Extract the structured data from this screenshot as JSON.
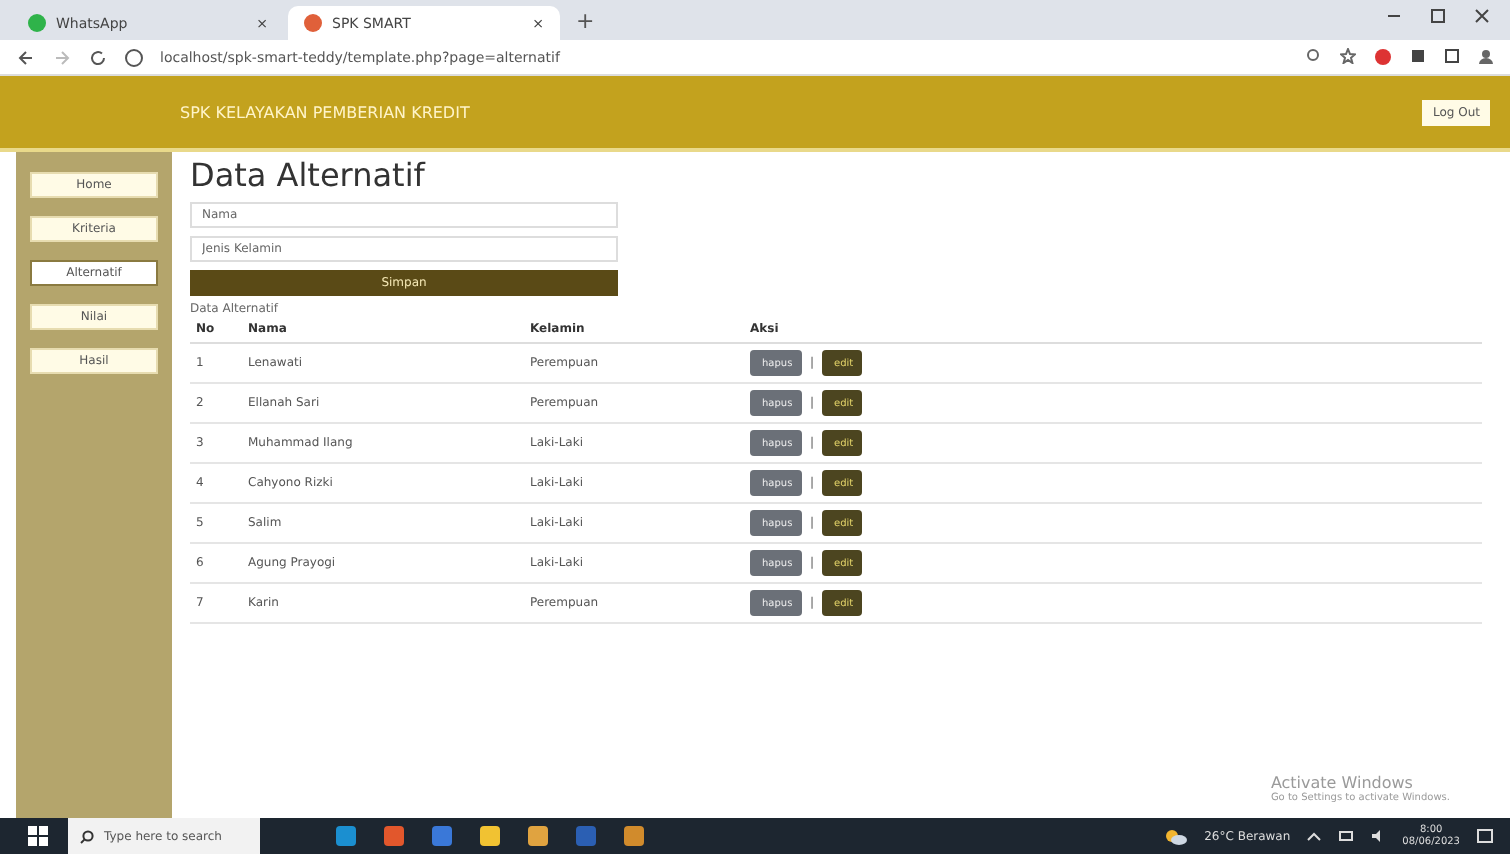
{
  "browser": {
    "tabs": [
      {
        "title": "WhatsApp",
        "close": "×",
        "selected": false
      },
      {
        "title": "SPK SMART",
        "close": "×",
        "selected": true
      }
    ],
    "new_tab": "+",
    "url": "localhost/spk-smart-teddy/template.php?page=alternatif"
  },
  "header": {
    "title": "SPK KELAYAKAN PEMBERIAN KREDIT",
    "logout": "Log Out"
  },
  "sidebar": {
    "items": [
      {
        "label": "Home",
        "selected": false
      },
      {
        "label": "Kriteria",
        "selected": false
      },
      {
        "label": "Alternatif",
        "selected": true
      },
      {
        "label": "Nilai",
        "selected": false
      },
      {
        "label": "Hasil",
        "selected": false
      }
    ]
  },
  "page_title": "Data Alternatif",
  "form": {
    "fields": [
      {
        "placeholder": "Nama"
      },
      {
        "placeholder": "Jenis Kelamin"
      }
    ],
    "submit": "Simpan"
  },
  "table": {
    "caption": "Data Alternatif",
    "columns": [
      "No",
      "Nama",
      "Kelamin",
      "Aksi"
    ],
    "rows": [
      {
        "no": "1",
        "nama": "Lenawati",
        "kelamin": "Perempuan",
        "delete": "hapus",
        "separator": "|",
        "edit": "edit"
      },
      {
        "no": "2",
        "nama": "Ellanah Sari",
        "kelamin": "Perempuan",
        "delete": "hapus",
        "separator": "|",
        "edit": "edit"
      },
      {
        "no": "3",
        "nama": "Muhammad Ilang",
        "kelamin": "Laki-Laki",
        "delete": "hapus",
        "separator": "|",
        "edit": "edit"
      },
      {
        "no": "4",
        "nama": "Cahyono Rizki",
        "kelamin": "Laki-Laki",
        "delete": "hapus",
        "separator": "|",
        "edit": "edit"
      },
      {
        "no": "5",
        "nama": "Salim",
        "kelamin": "Laki-Laki",
        "delete": "hapus",
        "separator": "|",
        "edit": "edit"
      },
      {
        "no": "6",
        "nama": "Agung Prayogi",
        "kelamin": "Laki-Laki",
        "delete": "hapus",
        "separator": "|",
        "edit": "edit"
      },
      {
        "no": "7",
        "nama": "Karin",
        "kelamin": "Perempuan",
        "delete": "hapus",
        "separator": "|",
        "edit": "edit"
      }
    ]
  },
  "activation": {
    "title": "Activate Windows",
    "hint": "Go to Settings to activate Windows."
  },
  "taskbar": {
    "search": "Type here to search",
    "weather": "26°C Berawan",
    "time": "8:00",
    "date": "08/06/2023"
  }
}
